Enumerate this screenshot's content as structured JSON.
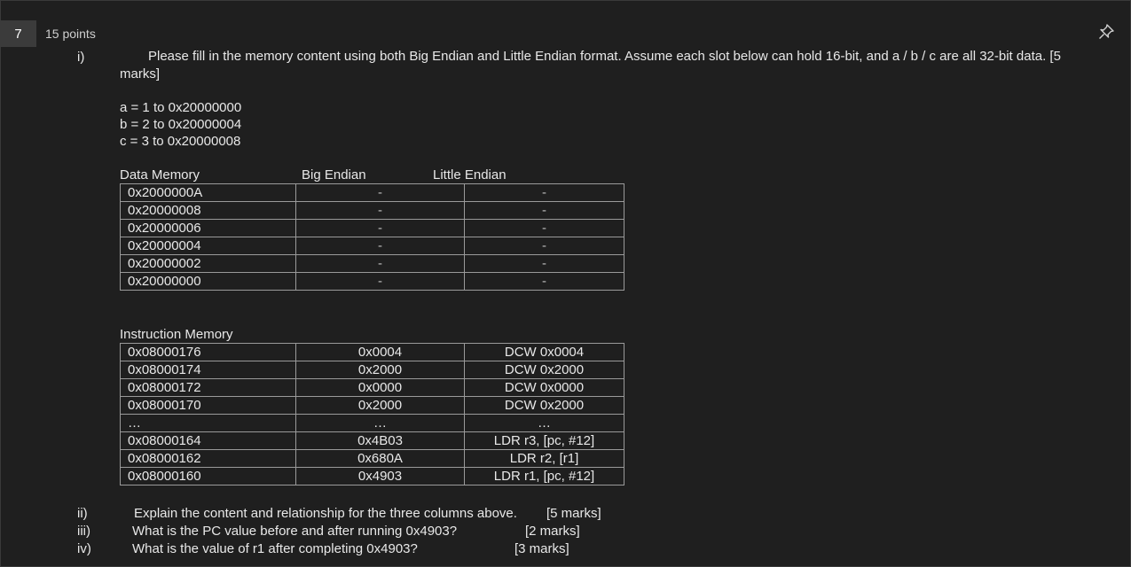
{
  "question": {
    "number": "7",
    "points": "15 points"
  },
  "part_i": {
    "label": "i)",
    "text_line1": "Please fill in the memory content using both Big Endian and Little Endian format. Assume each slot below can hold 16-bit, and a / b / c are all 32-bit data.   [5",
    "text_line2": "marks]",
    "assignments": [
      "a = 1 to 0x20000000",
      "b = 2 to 0x20000004",
      "c = 3 to 0x20000008"
    ]
  },
  "data_memory": {
    "title": "Data Memory",
    "col2_header": "Big Endian",
    "col3_header": "Little Endian",
    "rows": [
      {
        "addr": "0x2000000A",
        "big": "-",
        "little": "-"
      },
      {
        "addr": "0x20000008",
        "big": "-",
        "little": "-"
      },
      {
        "addr": "0x20000006",
        "big": "-",
        "little": "-"
      },
      {
        "addr": "0x20000004",
        "big": "-",
        "little": "-"
      },
      {
        "addr": "0x20000002",
        "big": "-",
        "little": "-"
      },
      {
        "addr": "0x20000000",
        "big": "-",
        "little": "-"
      }
    ]
  },
  "instruction_memory": {
    "title": "Instruction Memory",
    "rows": [
      {
        "addr": "0x08000176",
        "code": "0x0004",
        "asm": "DCW 0x0004"
      },
      {
        "addr": "0x08000174",
        "code": "0x2000",
        "asm": "DCW 0x2000"
      },
      {
        "addr": "0x08000172",
        "code": "0x0000",
        "asm": "DCW 0x0000"
      },
      {
        "addr": "0x08000170",
        "code": "0x2000",
        "asm": "DCW 0x2000"
      },
      {
        "addr": "…",
        "code": "…",
        "asm": "…"
      },
      {
        "addr": "0x08000164",
        "code": "0x4B03",
        "asm": "LDR r3, [pc, #12]"
      },
      {
        "addr": "0x08000162",
        "code": "0x680A",
        "asm": "LDR r2, [r1]"
      },
      {
        "addr": "0x08000160",
        "code": "0x4903",
        "asm": "LDR r1, [pc, #12]"
      }
    ]
  },
  "subquestions": [
    {
      "label": "ii)",
      "text": "Explain the content and relationship for the three columns above.",
      "marks": "[5 marks]"
    },
    {
      "label": "iii)",
      "text": "What is the PC value before and after running 0x4903?",
      "marks": "[2 marks]"
    },
    {
      "label": "iv)",
      "text": "What is the value of r1 after completing 0x4903?",
      "marks": "[3 marks]"
    }
  ],
  "icons": {
    "pin": "pin-icon"
  }
}
